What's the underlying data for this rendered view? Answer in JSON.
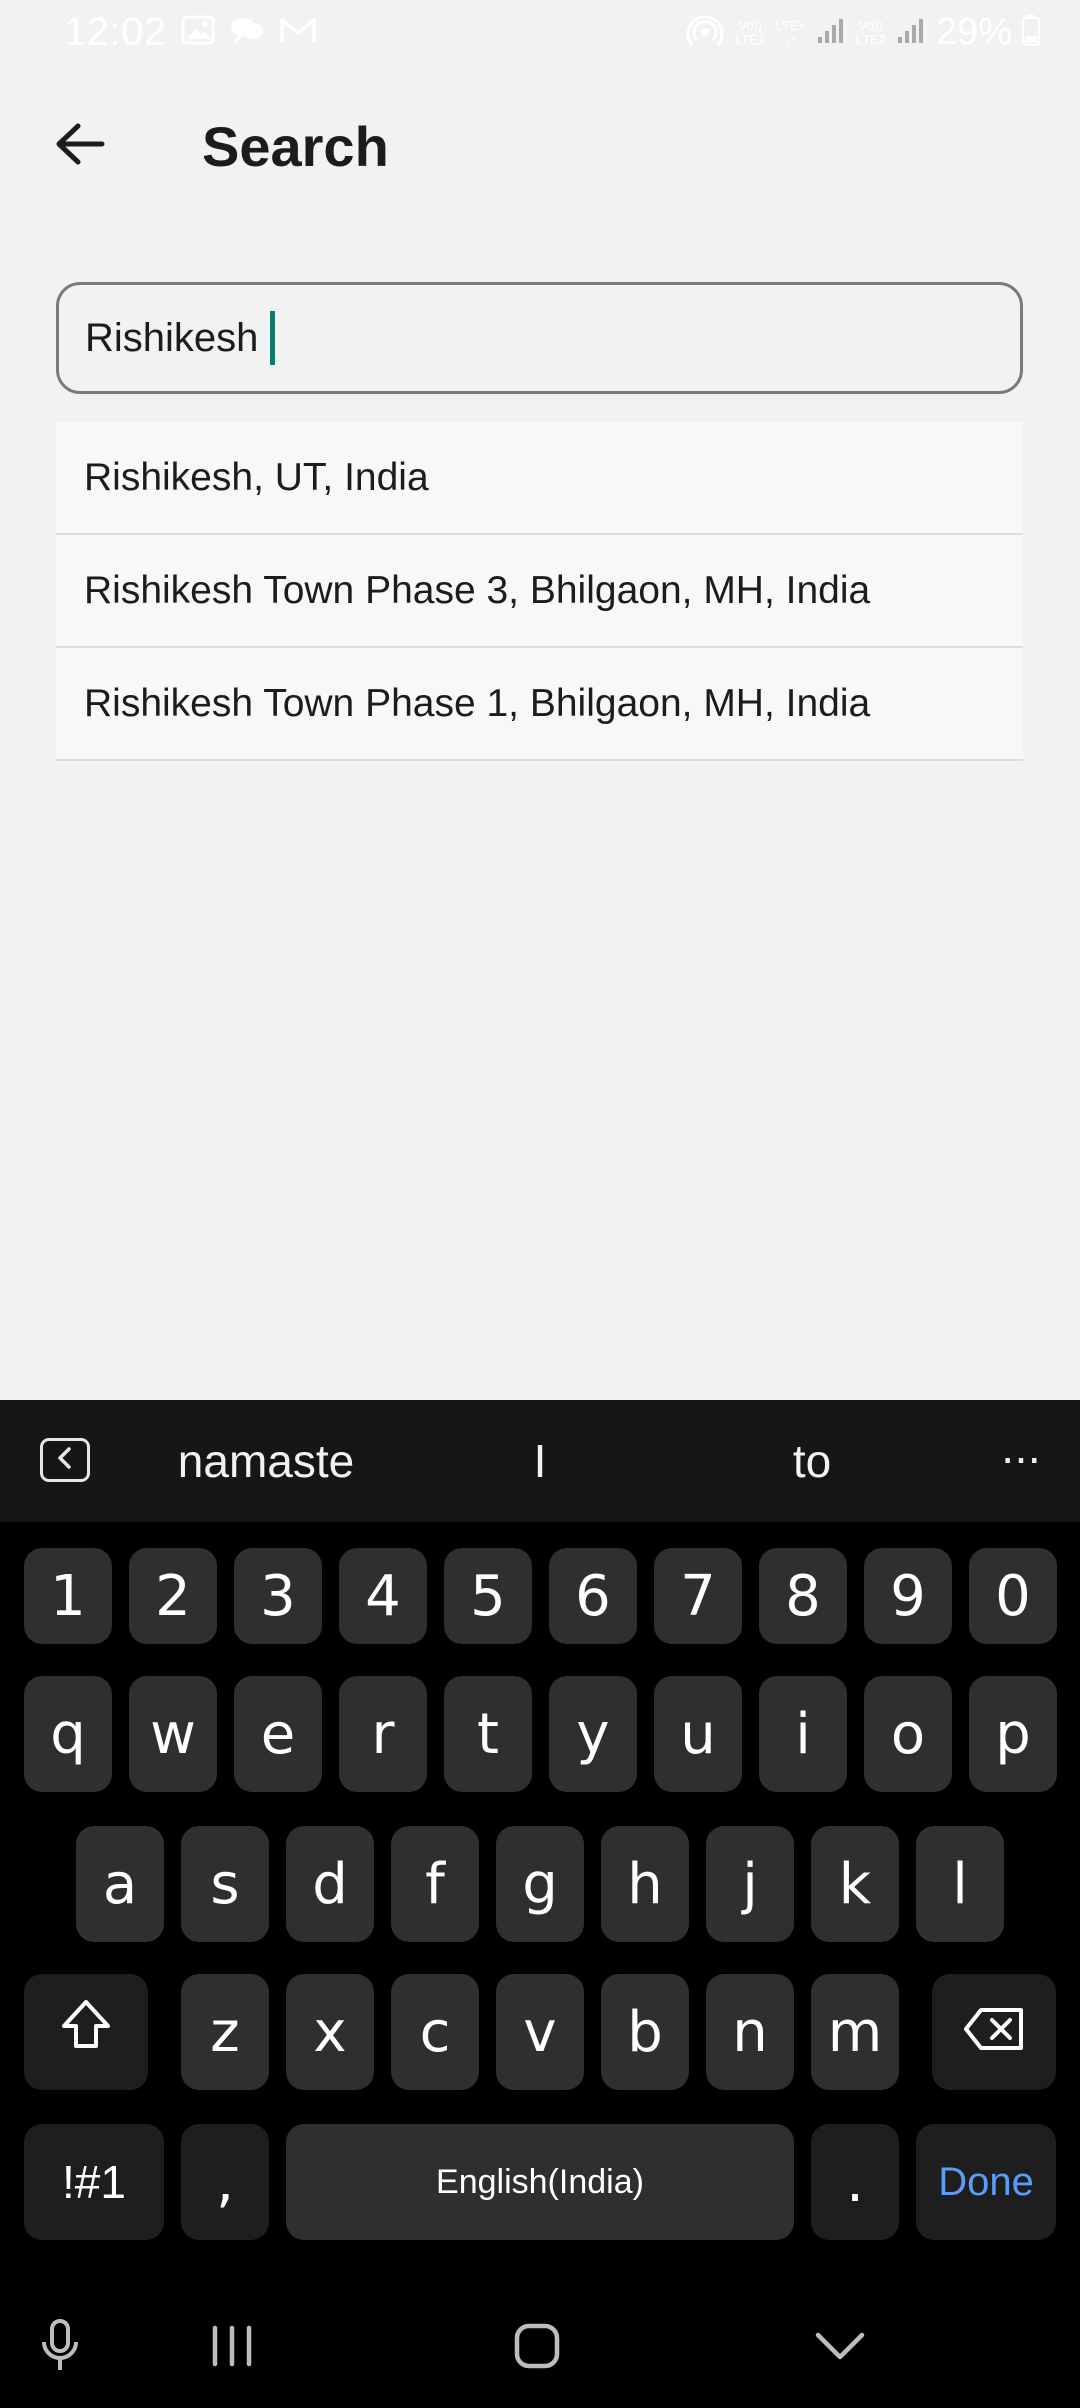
{
  "status_bar": {
    "time": "12:02",
    "signal_text_1_top": "Vo))",
    "signal_text_1_bottom": "LTE1",
    "signal_text_lte": "LTE+",
    "signal_text_2_top": "Vo))",
    "signal_text_2_bottom": "LTE2",
    "battery": "29%"
  },
  "header": {
    "title": "Search"
  },
  "search": {
    "value": "Rishikesh"
  },
  "suggestions": [
    {
      "label": "Rishikesh, UT, India"
    },
    {
      "label": "Rishikesh Town Phase 3, Bhilgaon, MH, India"
    },
    {
      "label": "Rishikesh Town Phase 1, Bhilgaon, MH, India"
    }
  ],
  "keyboard": {
    "predictions": [
      "namaste",
      "I",
      "to"
    ],
    "more": "···",
    "row_numbers": [
      "1",
      "2",
      "3",
      "4",
      "5",
      "6",
      "7",
      "8",
      "9",
      "0"
    ],
    "row_top": [
      "q",
      "w",
      "e",
      "r",
      "t",
      "y",
      "u",
      "i",
      "o",
      "p"
    ],
    "row_home": [
      "a",
      "s",
      "d",
      "f",
      "g",
      "h",
      "j",
      "k",
      "l"
    ],
    "row_bottom": [
      "z",
      "x",
      "c",
      "v",
      "b",
      "n",
      "m"
    ],
    "symbols": "!#1",
    "comma": ",",
    "space": "English(India)",
    "period": ".",
    "done": "Done"
  },
  "colors": {
    "accent_caret": "#0f7a6c",
    "done_blue": "#5b9cf5",
    "background": "#f2f2f2",
    "keyboard_bg": "#000000",
    "key_bg": "#2f2f2f"
  }
}
